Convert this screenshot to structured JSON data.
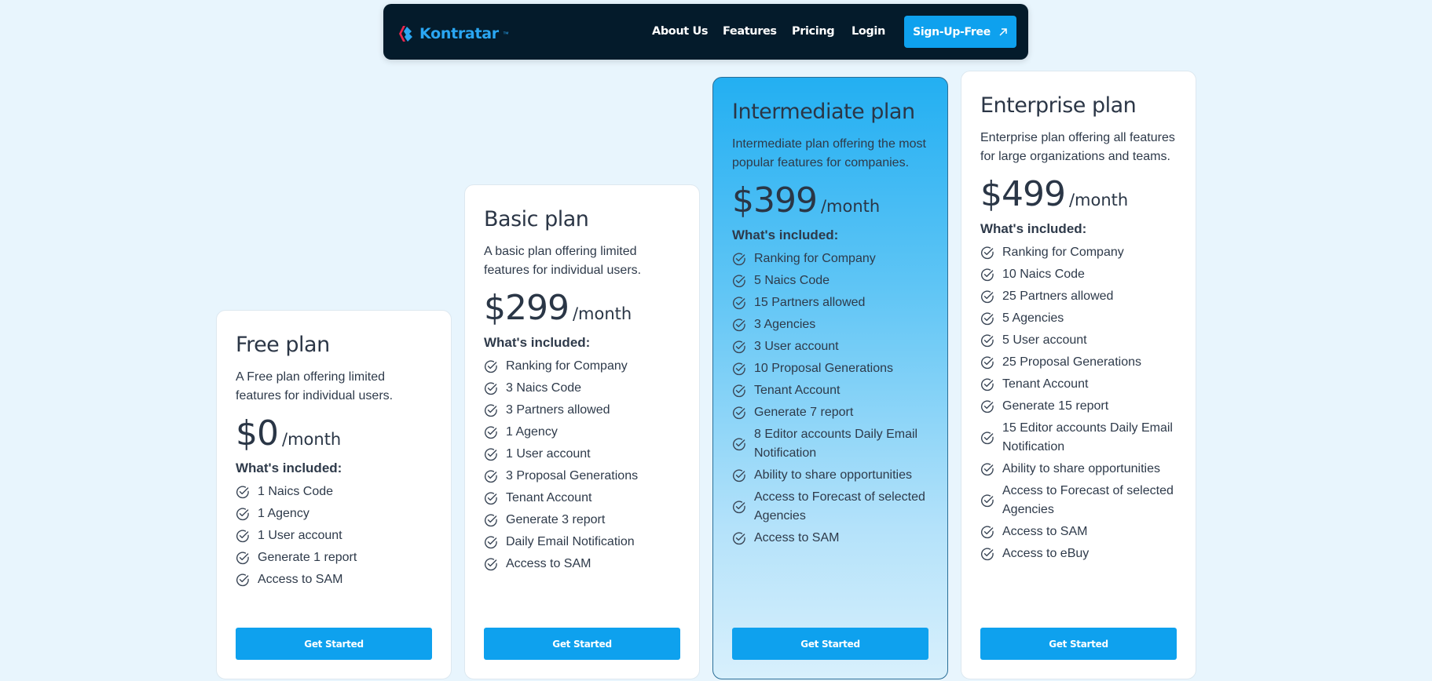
{
  "nav": {
    "logo_text": "Kontratar",
    "logo_tm": "™",
    "links": [
      "About Us",
      "Features",
      "Pricing",
      "Login"
    ],
    "signup_label": "Sign-Up-Free"
  },
  "plans": [
    {
      "title": "Free plan",
      "description": "A Free plan offering limited features for individual users.",
      "price": "$0",
      "period": "/month",
      "included_label": "What's included:",
      "features": [
        "1 Naics Code",
        "1 Agency",
        "1 User account",
        "Generate 1 report",
        "Access to SAM"
      ],
      "cta": "Get Started"
    },
    {
      "title": "Basic plan",
      "description": "A basic plan offering limited features for individual users.",
      "price": "$299",
      "period": "/month",
      "included_label": "What's included:",
      "features": [
        "Ranking for Company",
        "3 Naics Code",
        "3 Partners allowed",
        "1 Agency",
        "1 User account",
        "3 Proposal Generations",
        "Tenant Account",
        "Generate 3 report",
        "Daily Email Notification",
        "Access to SAM"
      ],
      "cta": "Get Started"
    },
    {
      "title": "Intermediate plan",
      "description": "Intermediate plan offering the most popular features for companies.",
      "price": "$399",
      "period": "/month",
      "included_label": "What's included:",
      "features": [
        "Ranking for Company",
        "5 Naics Code",
        "15 Partners allowed",
        "3 Agencies",
        "3 User account",
        "10 Proposal Generations",
        "Tenant Account",
        "Generate 7 report",
        "8 Editor accounts Daily Email Notification",
        "Ability to share opportunities",
        "Access to Forecast of selected Agencies",
        "Access to SAM"
      ],
      "cta": "Get Started"
    },
    {
      "title": "Enterprise plan",
      "description": "Enterprise plan offering all features for large organizations and teams.",
      "price": "$499",
      "period": "/month",
      "included_label": "What's included:",
      "features": [
        "Ranking for Company",
        "10 Naics Code",
        "25 Partners allowed",
        "5 Agencies",
        "5 User account",
        "25 Proposal Generations",
        "Tenant Account",
        "Generate 15 report",
        "15 Editor accounts Daily Email Notification",
        "Ability to share opportunities",
        "Access to Forecast of selected Agencies",
        "Access to SAM",
        "Access to eBuy"
      ],
      "cta": "Get Started"
    }
  ],
  "colors": {
    "accent": "#0ea1ee",
    "nav_bg": "#041b2b",
    "page_bg": "#e8f5fd"
  }
}
